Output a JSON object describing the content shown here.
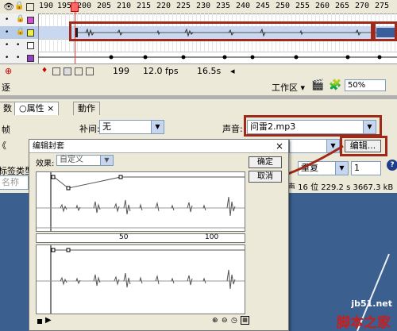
{
  "timeline": {
    "ruler_ticks": [
      "190",
      "195",
      "200",
      "205",
      "210",
      "215",
      "220",
      "225",
      "230",
      "235",
      "240",
      "245",
      "250",
      "255",
      "260",
      "265",
      "270",
      "275"
    ],
    "status": {
      "frame": "199",
      "fps": "12.0 fps",
      "time": "16.5s"
    }
  },
  "workspace": {
    "label": "工作区",
    "zoom": "50%"
  },
  "panel": {
    "left_label": "逐",
    "tabs": [
      "数",
      "○属性",
      "×",
      "動作"
    ],
    "tween_label": "补间:",
    "tween_value": "无",
    "sound_label": "声音:",
    "sound_value": "问雷2.mp3",
    "edit_button": "编辑...",
    "frame_label_type": "标签类型:",
    "name_placeholder": "名称",
    "repeat_value": "重复",
    "repeat_count": "1",
    "sound_info": "声 16 位 229.2 s 3667.3 kB"
  },
  "dialog": {
    "title": "编辑封套",
    "effect_label": "效果:",
    "effect_value": "自定义",
    "ok_button": "确定",
    "cancel_button": "取消",
    "ruler_labels": [
      "50",
      "100"
    ]
  },
  "watermark": {
    "site": "jb51.net",
    "name": "脚本之家"
  }
}
